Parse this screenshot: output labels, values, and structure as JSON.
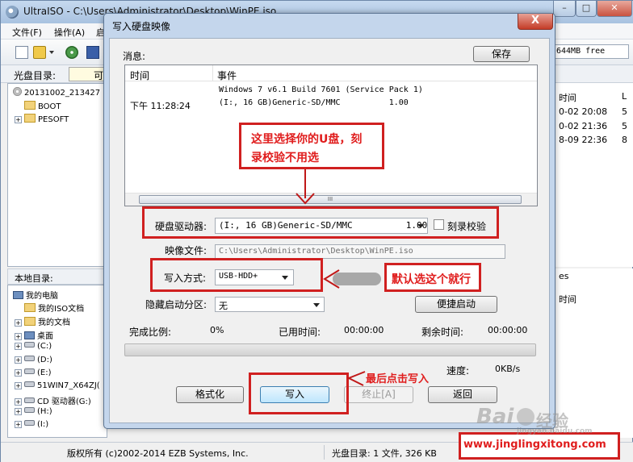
{
  "main_window": {
    "title": "UltraISO - C:\\Users\\Administrator\\Desktop\\WinPE.iso",
    "menu": [
      "文件(F)",
      "操作(A)",
      "启"
    ],
    "free_space": "644MB free",
    "disc_dir_label": "光盘目录:",
    "disc_dir_value": "可引",
    "disc_tree": [
      {
        "label": "20131002_213427",
        "icon": "disc-icon"
      },
      {
        "label": "BOOT",
        "icon": "folder-icon"
      },
      {
        "label": "PESOFT",
        "icon": "folder-icon"
      }
    ],
    "right_top": {
      "header": "时间",
      "header2": "L",
      "rows": [
        "0-02 20:08",
        "0-02 21:36",
        "8-09 22:36"
      ],
      "sizes": [
        "5",
        "5",
        "8"
      ]
    },
    "local_dir_label": "本地目录:",
    "local_tree": [
      {
        "label": "我的电脑",
        "icon": "computer-icon"
      },
      {
        "label": "我的ISO文档",
        "icon": "folder-icon"
      },
      {
        "label": "我的文档",
        "icon": "folder-icon"
      },
      {
        "label": "桌面",
        "icon": "desktop-icon"
      },
      {
        "label": "(C:)",
        "icon": "drive-icon"
      },
      {
        "label": "(D:)",
        "icon": "drive-icon"
      },
      {
        "label": "(E:)",
        "icon": "drive-icon"
      },
      {
        "label": "51WIN7_X64ZJ(",
        "icon": "drive-icon"
      },
      {
        "label": "CD 驱动器(G:)",
        "icon": "cd-drive-icon"
      },
      {
        "label": "(H:)",
        "icon": "drive-icon"
      },
      {
        "label": "(I:)",
        "icon": "drive-icon"
      }
    ],
    "right_bottom": {
      "header": "es",
      "header2": "时间"
    },
    "status": {
      "copyright": "版权所有  (c)2002-2014 EZB Systems, Inc.",
      "disc_info": "光盘目录: 1 文件, 326 KB"
    }
  },
  "dialog": {
    "title": "写入硬盘映像",
    "close_label": "X",
    "messages_label": "消息:",
    "save_label": "保存",
    "col_time": "时间",
    "col_event": "事件",
    "rows": [
      {
        "time": "",
        "event": "Windows 7 v6.1 Build 7601 (Service Pack 1)"
      },
      {
        "time": "下午 11:28:24",
        "event": "(I:, 16 GB)Generic-SD/MMC          1.00"
      }
    ],
    "scroll_grip": "III",
    "drive_label": "硬盘驱动器:",
    "drive_value": "(I:, 16 GB)Generic-SD/MMC          1.00",
    "verify_label": "刻录校验",
    "image_label": "映像文件:",
    "image_value": "C:\\Users\\Administrator\\Desktop\\WinPE.iso",
    "method_label": "写入方式:",
    "method_value": "USB-HDD+",
    "hidden_label": "隐藏启动分区:",
    "hidden_value": "无",
    "quick_boot_label": "便捷启动",
    "complete_label": "完成比例:",
    "complete_value": "0%",
    "elapsed_label": "已用时间:",
    "elapsed_value": "00:00:00",
    "remaining_label": "剩余时间:",
    "remaining_value": "00:00:00",
    "speed_label": "速度:",
    "speed_value": "0KB/s",
    "progress": 0,
    "format_label": "格式化",
    "write_label": "写入",
    "stop_label": "终止[A]",
    "back_label": "返回"
  },
  "annotations": {
    "select_udisk": [
      "这里选择你的U盘，刻",
      "录校验不用选"
    ],
    "default_method": "默认选这个就行",
    "click_write": "最后点击写入",
    "site": "www.jinglingxitong.com",
    "watermark": "Bai",
    "watermark2": "经验",
    "watermark_sub": "jingyan.baidu.com"
  },
  "colors": {
    "annotation_red": "#d02020",
    "dialog_frame": "#c4d6ec"
  }
}
